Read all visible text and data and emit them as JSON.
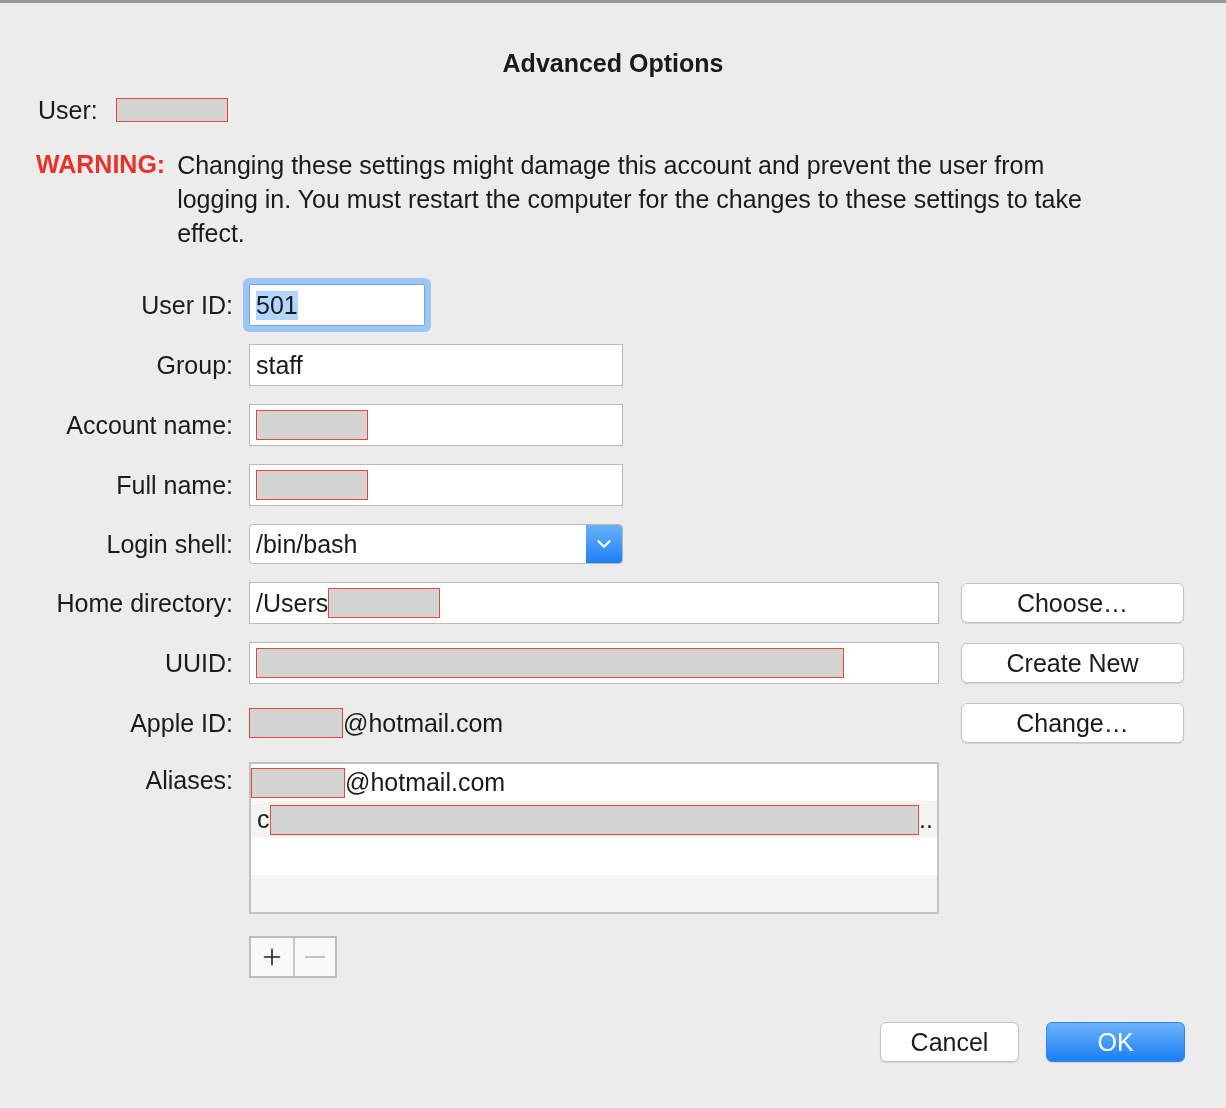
{
  "dialog": {
    "title": "Advanced Options"
  },
  "user": {
    "label": "User:",
    "parts": [
      {
        "kind": "redaction"
      }
    ]
  },
  "warning": {
    "label": "WARNING:",
    "text": "Changing these settings might damage this account and prevent the user from logging in. You must restart the computer for the changes to these settings to take effect."
  },
  "fields": [
    {
      "kind": "number",
      "label": "User ID:",
      "focused": true,
      "parts": [
        {
          "kind": "text",
          "text": "501"
        }
      ]
    },
    {
      "kind": "text",
      "label": "Group:",
      "focused": false,
      "parts": [
        {
          "kind": "text",
          "text": "staff"
        }
      ]
    },
    {
      "kind": "text",
      "label": "Account name:",
      "focused": false,
      "parts": [
        {
          "kind": "redaction"
        }
      ]
    },
    {
      "kind": "text",
      "label": "Full name:",
      "focused": false,
      "parts": [
        {
          "kind": "redaction"
        }
      ]
    },
    {
      "kind": "select",
      "label": "Login shell:",
      "parts": [
        {
          "kind": "text",
          "text": "/bin/bash"
        }
      ]
    },
    {
      "kind": "text",
      "label": "Home directory:",
      "focused": false,
      "button": "Choose…",
      "parts": [
        {
          "kind": "text",
          "text": "/Users"
        },
        {
          "kind": "redaction"
        }
      ]
    },
    {
      "kind": "text",
      "label": "UUID:",
      "focused": false,
      "button": "Create New",
      "parts": [
        {
          "kind": "redaction",
          "fill": true
        }
      ]
    },
    {
      "kind": "static",
      "label": "Apple ID:",
      "button": "Change…",
      "parts": [
        {
          "kind": "redaction"
        },
        {
          "kind": "text",
          "text": "@hotmail.com"
        }
      ]
    },
    {
      "kind": "list",
      "label": "Aliases:",
      "rows": [
        {
          "parts": [
            {
              "kind": "redaction"
            },
            {
              "kind": "text",
              "text": "@hotmail.com"
            }
          ]
        },
        {
          "parts": [
            {
              "kind": "text",
              "text": "c"
            },
            {
              "kind": "redaction",
              "fill": true
            },
            {
              "kind": "text",
              "text": ".."
            }
          ]
        }
      ],
      "controls": [
        {
          "kind": "add",
          "disabled": false
        },
        {
          "kind": "remove",
          "disabled": true
        }
      ]
    }
  ],
  "buttons": [
    {
      "label": "Cancel",
      "default": false
    },
    {
      "label": "OK",
      "default": true
    }
  ]
}
